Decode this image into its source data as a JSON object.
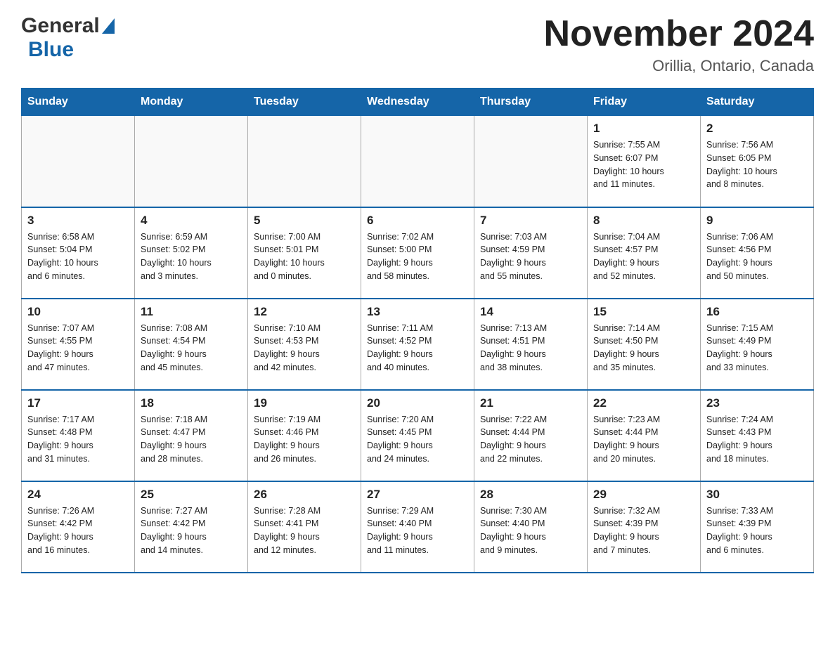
{
  "header": {
    "logo_general": "General",
    "logo_blue": "Blue",
    "month_title": "November 2024",
    "location": "Orillia, Ontario, Canada"
  },
  "days_of_week": [
    "Sunday",
    "Monday",
    "Tuesday",
    "Wednesday",
    "Thursday",
    "Friday",
    "Saturday"
  ],
  "weeks": [
    [
      {
        "day": "",
        "info": ""
      },
      {
        "day": "",
        "info": ""
      },
      {
        "day": "",
        "info": ""
      },
      {
        "day": "",
        "info": ""
      },
      {
        "day": "",
        "info": ""
      },
      {
        "day": "1",
        "info": "Sunrise: 7:55 AM\nSunset: 6:07 PM\nDaylight: 10 hours\nand 11 minutes."
      },
      {
        "day": "2",
        "info": "Sunrise: 7:56 AM\nSunset: 6:05 PM\nDaylight: 10 hours\nand 8 minutes."
      }
    ],
    [
      {
        "day": "3",
        "info": "Sunrise: 6:58 AM\nSunset: 5:04 PM\nDaylight: 10 hours\nand 6 minutes."
      },
      {
        "day": "4",
        "info": "Sunrise: 6:59 AM\nSunset: 5:02 PM\nDaylight: 10 hours\nand 3 minutes."
      },
      {
        "day": "5",
        "info": "Sunrise: 7:00 AM\nSunset: 5:01 PM\nDaylight: 10 hours\nand 0 minutes."
      },
      {
        "day": "6",
        "info": "Sunrise: 7:02 AM\nSunset: 5:00 PM\nDaylight: 9 hours\nand 58 minutes."
      },
      {
        "day": "7",
        "info": "Sunrise: 7:03 AM\nSunset: 4:59 PM\nDaylight: 9 hours\nand 55 minutes."
      },
      {
        "day": "8",
        "info": "Sunrise: 7:04 AM\nSunset: 4:57 PM\nDaylight: 9 hours\nand 52 minutes."
      },
      {
        "day": "9",
        "info": "Sunrise: 7:06 AM\nSunset: 4:56 PM\nDaylight: 9 hours\nand 50 minutes."
      }
    ],
    [
      {
        "day": "10",
        "info": "Sunrise: 7:07 AM\nSunset: 4:55 PM\nDaylight: 9 hours\nand 47 minutes."
      },
      {
        "day": "11",
        "info": "Sunrise: 7:08 AM\nSunset: 4:54 PM\nDaylight: 9 hours\nand 45 minutes."
      },
      {
        "day": "12",
        "info": "Sunrise: 7:10 AM\nSunset: 4:53 PM\nDaylight: 9 hours\nand 42 minutes."
      },
      {
        "day": "13",
        "info": "Sunrise: 7:11 AM\nSunset: 4:52 PM\nDaylight: 9 hours\nand 40 minutes."
      },
      {
        "day": "14",
        "info": "Sunrise: 7:13 AM\nSunset: 4:51 PM\nDaylight: 9 hours\nand 38 minutes."
      },
      {
        "day": "15",
        "info": "Sunrise: 7:14 AM\nSunset: 4:50 PM\nDaylight: 9 hours\nand 35 minutes."
      },
      {
        "day": "16",
        "info": "Sunrise: 7:15 AM\nSunset: 4:49 PM\nDaylight: 9 hours\nand 33 minutes."
      }
    ],
    [
      {
        "day": "17",
        "info": "Sunrise: 7:17 AM\nSunset: 4:48 PM\nDaylight: 9 hours\nand 31 minutes."
      },
      {
        "day": "18",
        "info": "Sunrise: 7:18 AM\nSunset: 4:47 PM\nDaylight: 9 hours\nand 28 minutes."
      },
      {
        "day": "19",
        "info": "Sunrise: 7:19 AM\nSunset: 4:46 PM\nDaylight: 9 hours\nand 26 minutes."
      },
      {
        "day": "20",
        "info": "Sunrise: 7:20 AM\nSunset: 4:45 PM\nDaylight: 9 hours\nand 24 minutes."
      },
      {
        "day": "21",
        "info": "Sunrise: 7:22 AM\nSunset: 4:44 PM\nDaylight: 9 hours\nand 22 minutes."
      },
      {
        "day": "22",
        "info": "Sunrise: 7:23 AM\nSunset: 4:44 PM\nDaylight: 9 hours\nand 20 minutes."
      },
      {
        "day": "23",
        "info": "Sunrise: 7:24 AM\nSunset: 4:43 PM\nDaylight: 9 hours\nand 18 minutes."
      }
    ],
    [
      {
        "day": "24",
        "info": "Sunrise: 7:26 AM\nSunset: 4:42 PM\nDaylight: 9 hours\nand 16 minutes."
      },
      {
        "day": "25",
        "info": "Sunrise: 7:27 AM\nSunset: 4:42 PM\nDaylight: 9 hours\nand 14 minutes."
      },
      {
        "day": "26",
        "info": "Sunrise: 7:28 AM\nSunset: 4:41 PM\nDaylight: 9 hours\nand 12 minutes."
      },
      {
        "day": "27",
        "info": "Sunrise: 7:29 AM\nSunset: 4:40 PM\nDaylight: 9 hours\nand 11 minutes."
      },
      {
        "day": "28",
        "info": "Sunrise: 7:30 AM\nSunset: 4:40 PM\nDaylight: 9 hours\nand 9 minutes."
      },
      {
        "day": "29",
        "info": "Sunrise: 7:32 AM\nSunset: 4:39 PM\nDaylight: 9 hours\nand 7 minutes."
      },
      {
        "day": "30",
        "info": "Sunrise: 7:33 AM\nSunset: 4:39 PM\nDaylight: 9 hours\nand 6 minutes."
      }
    ]
  ]
}
